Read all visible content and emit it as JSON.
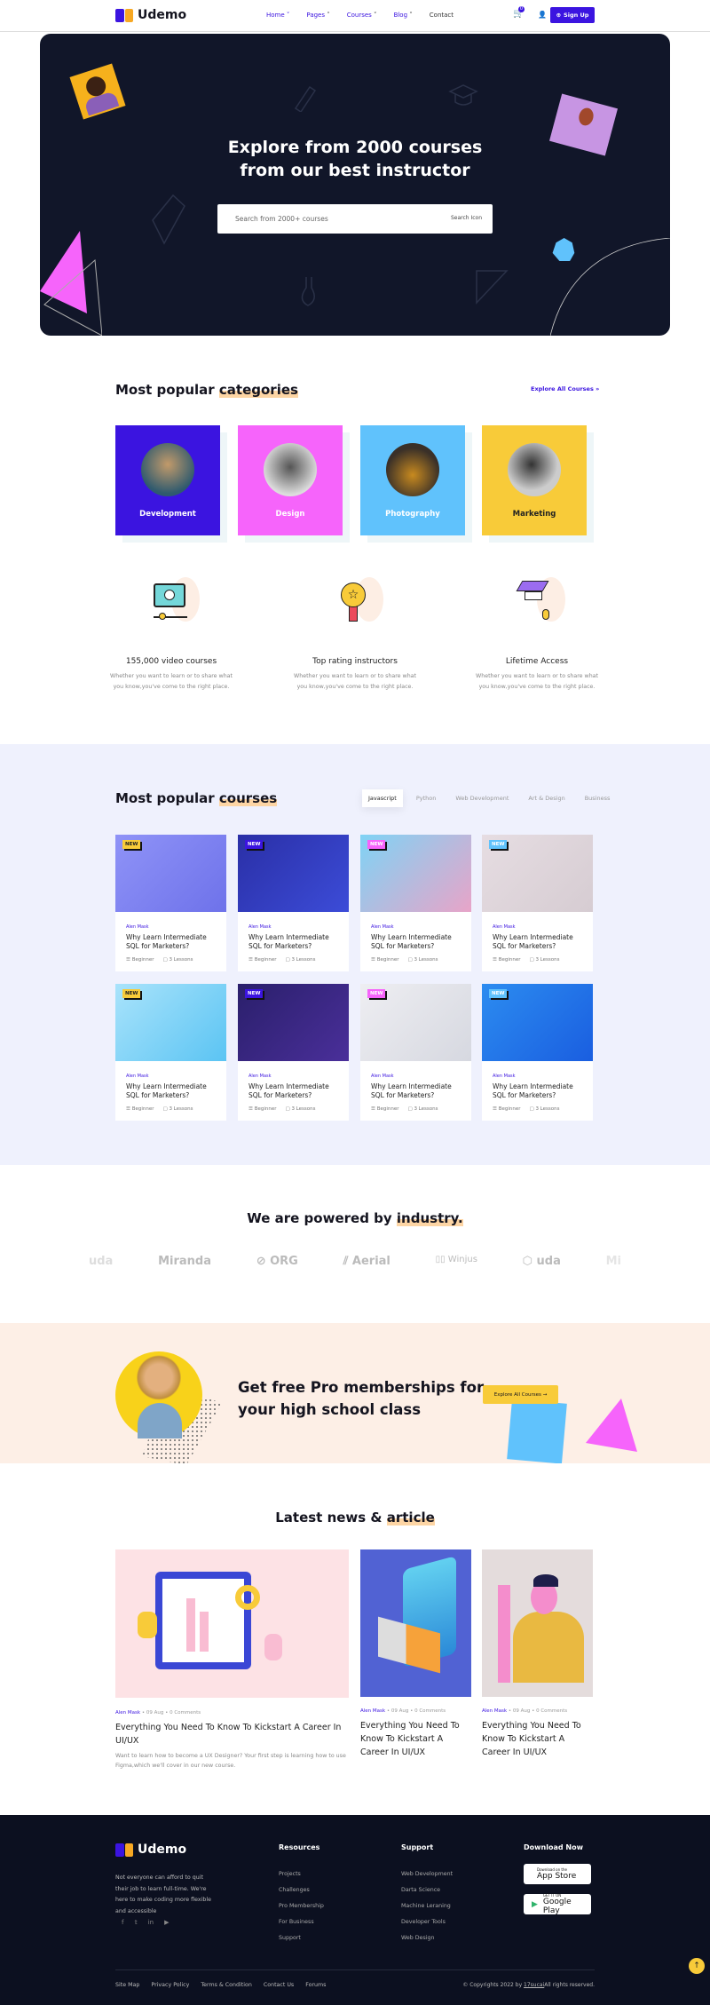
{
  "header": {
    "brand": "Udemo",
    "nav": [
      "Home",
      "Pages",
      "Courses",
      "Blog",
      "Contact"
    ],
    "cart_count": "0",
    "signup": "Sign Up"
  },
  "hero": {
    "title_1": "Explore from 2000 courses",
    "title_2": "from our best instructor",
    "search_placeholder": "Search from 2000+ courses",
    "search_icon_alt": "Search Icon"
  },
  "categories": {
    "title": "Most popular ",
    "title_hl": "categories",
    "explore": "Explore All Courses",
    "items": [
      {
        "label": "Development",
        "color": "#3b14e0"
      },
      {
        "label": "Design",
        "color": "#f664fb"
      },
      {
        "label": "Photography",
        "color": "#60c2fc"
      },
      {
        "label": "Marketing",
        "color": "#f8cb39"
      }
    ]
  },
  "features": [
    {
      "title": "155,000 video courses",
      "desc": "Whether you want to learn or to share what you know,you've come to the right place.",
      "icon": "video-play-icon"
    },
    {
      "title": "Top rating instructors",
      "desc": "Whether you want to learn or to share what you know,you've come to the right place.",
      "icon": "medal-star-icon"
    },
    {
      "title": "Lifetime Access",
      "desc": "Whether you want to learn or to share what you know,you've come to the right place.",
      "icon": "graduation-cap-mouse-icon"
    }
  ],
  "courses": {
    "title": "Most popular ",
    "title_hl": "courses",
    "tabs": [
      "Javascript",
      "Python",
      "Web Development",
      "Art & Design",
      "Business"
    ],
    "active_tab": "Javascript",
    "items": [
      {
        "badge": "NEW",
        "badge_color": "#f8cb39",
        "author": "Alen Mask",
        "title": "Why Learn Intermediate SQL for Marketers?",
        "level": "Beginner",
        "lessons": "3 Lessons"
      },
      {
        "badge": "NEW",
        "badge_color": "#3b14e0",
        "author": "Alen Mask",
        "title": "Why Learn Intermediate SQL for Marketers?",
        "level": "Beginner",
        "lessons": "3 Lessons"
      },
      {
        "badge": "NEW",
        "badge_color": "#f664fb",
        "author": "Alen Mask",
        "title": "Why Learn Intermediate SQL for Marketers?",
        "level": "Beginner",
        "lessons": "3 Lessons"
      },
      {
        "badge": "NEW",
        "badge_color": "#60c2fc",
        "author": "Alen Mask",
        "title": "Why Learn Intermediate SQL for Marketers?",
        "level": "Beginner",
        "lessons": "3 Lessons"
      },
      {
        "badge": "NEW",
        "badge_color": "#f8cb39",
        "author": "Alen Mask",
        "title": "Why Learn Intermediate SQL for Marketers?",
        "level": "Beginner",
        "lessons": "3 Lessons"
      },
      {
        "badge": "NEW",
        "badge_color": "#3b14e0",
        "author": "Alen Mask",
        "title": "Why Learn Intermediate SQL for Marketers?",
        "level": "Beginner",
        "lessons": "3 Lessons"
      },
      {
        "badge": "NEW",
        "badge_color": "#f664fb",
        "author": "Alen Mask",
        "title": "Why Learn Intermediate SQL for Marketers?",
        "level": "Beginner",
        "lessons": "3 Lessons"
      },
      {
        "badge": "NEW",
        "badge_color": "#60c2fc",
        "author": "Alen Mask",
        "title": "Why Learn Intermediate SQL for Marketers?",
        "level": "Beginner",
        "lessons": "3 Lessons"
      }
    ]
  },
  "industry": {
    "title": "We are powered by ",
    "title_hl": "industry.",
    "logos": [
      "uda",
      "Miranda",
      "ORG",
      "Aerial",
      "Winjus",
      "uda",
      "Mi"
    ]
  },
  "cta": {
    "title_1": "Get free Pro memberships for",
    "title_2": "your high school class",
    "button": "Explore All Courses →"
  },
  "news": {
    "title": "Latest news & ",
    "title_hl": "article",
    "items": [
      {
        "author": "Alen Mask",
        "date": "09 Aug",
        "comments": "0 Comments",
        "title": "Everything You Need To Know To Kickstart A Career In UI/UX",
        "excerpt": "Want to learn how to become a UX Designer? Your first step is learning how to use Figma,which we'll cover in our new course."
      },
      {
        "author": "Alen Mask",
        "date": "09 Aug",
        "comments": "0 Comments",
        "title": "Everything You Need To Know To Kickstart A Career In UI/UX"
      },
      {
        "author": "Alen Mask",
        "date": "09 Aug",
        "comments": "0 Comments",
        "title": "Everything You Need To Know To Kickstart A Career In UI/UX"
      }
    ]
  },
  "footer": {
    "brand": "Udemo",
    "about": "Not everyone can afford to quit their job to learn full-time. We're here to make coding more flexible and accessible",
    "resources": {
      "title": "Resources",
      "links": [
        "Projects",
        "Challenges",
        "Pro Membership",
        "For Business",
        "Support"
      ]
    },
    "support": {
      "title": "Support",
      "links": [
        "Web Development",
        "Darta Science",
        "Machine Leraning",
        "Developer Tools",
        "Web Design"
      ]
    },
    "download": {
      "title": "Download Now",
      "app_store_small": "Download on the",
      "app_store": "App Store",
      "google_small": "GET IT ON",
      "google": "Google Play"
    },
    "bottom_links": [
      "Site Map",
      "Privacy Policy",
      "Terms & Condition",
      "Contact Us",
      "Forums"
    ],
    "copyright": "© Copyrights 2022 by ",
    "copyright_link": "17sucai",
    "copyright_end": "All rights reserved."
  }
}
